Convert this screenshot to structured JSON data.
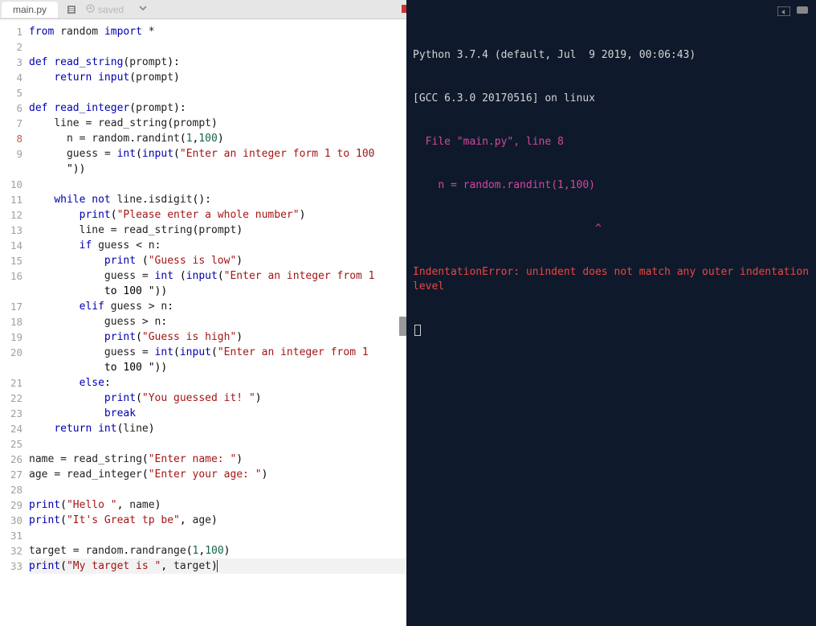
{
  "header": {
    "filename": "main.py",
    "saved_label": "saved"
  },
  "code_lines": [
    {
      "n": 1,
      "html": "<span class='kw'>from</span> <span class='id'>random</span> <span class='kw'>import</span> <span class='op'>*</span>"
    },
    {
      "n": 2,
      "html": ""
    },
    {
      "n": 3,
      "html": "<span class='kw'>def</span> <span class='fname'>read_string</span>(<span class='id'>prompt</span>):"
    },
    {
      "n": 4,
      "html": "    <span class='kw'>return</span> <span class='builtin'>input</span>(<span class='id'>prompt</span>)"
    },
    {
      "n": 5,
      "html": ""
    },
    {
      "n": 6,
      "html": "<span class='kw'>def</span> <span class='fname'>read_integer</span>(<span class='id'>prompt</span>):"
    },
    {
      "n": 7,
      "html": "    <span class='id'>line</span> <span class='op'>=</span> <span class='id'>read_string</span>(<span class='id'>prompt</span>)"
    },
    {
      "n": 8,
      "err": true,
      "html": "      <span class='id'>n</span> <span class='op'>=</span> <span class='id'>random</span>.<span class='id'>randint</span>(<span class='num'>1</span>,<span class='num'>100</span>)"
    },
    {
      "n": 9,
      "html": "      <span class='id'>guess</span> <span class='op'>=</span> <span class='builtin'>int</span>(<span class='builtin'>input</span>(<span class='str'>\"Enter an integer form 1 to 100 \n      \"</span>))"
    },
    {
      "n": 10,
      "html": ""
    },
    {
      "n": 11,
      "html": "    <span class='kw'>while</span> <span class='kw'>not</span> <span class='id'>line</span>.<span class='id'>isdigit</span>():"
    },
    {
      "n": 12,
      "html": "        <span class='builtin'>print</span>(<span class='str'>\"Please enter a whole number\"</span>)"
    },
    {
      "n": 13,
      "html": "        <span class='id'>line</span> <span class='op'>=</span> <span class='id'>read_string</span>(<span class='id'>prompt</span>)"
    },
    {
      "n": 14,
      "html": "        <span class='kw'>if</span> <span class='id'>guess</span> <span class='op'>&lt;</span> <span class='id'>n</span>:"
    },
    {
      "n": 15,
      "html": "            <span class='builtin'>print</span> (<span class='str'>\"Guess is low\"</span>)"
    },
    {
      "n": 16,
      "html": "            <span class='id'>guess</span> <span class='op'>=</span> <span class='builtin'>int</span> (<span class='builtin'>input</span>(<span class='str'>\"Enter an integer from 1 \n            to 100 \"</span>))"
    },
    {
      "n": 17,
      "html": "        <span class='kw'>elif</span> <span class='id'>guess</span> <span class='op'>&gt;</span> <span class='id'>n</span>:"
    },
    {
      "n": 18,
      "html": "            <span class='id'>guess</span> <span class='op'>&gt;</span> <span class='id'>n</span>:"
    },
    {
      "n": 19,
      "html": "            <span class='builtin'>print</span>(<span class='str'>\"Guess is high\"</span>)"
    },
    {
      "n": 20,
      "html": "            <span class='id'>guess</span> <span class='op'>=</span> <span class='builtin'>int</span>(<span class='builtin'>input</span>(<span class='str'>\"Enter an integer from 1 \n            to 100 \"</span>))"
    },
    {
      "n": 21,
      "html": "        <span class='kw'>else</span>:"
    },
    {
      "n": 22,
      "html": "            <span class='builtin'>print</span>(<span class='str'>\"You guessed it! \"</span>)"
    },
    {
      "n": 23,
      "html": "            <span class='kw'>break</span>"
    },
    {
      "n": 24,
      "html": "    <span class='kw'>return</span> <span class='builtin'>int</span>(<span class='id'>line</span>)"
    },
    {
      "n": 25,
      "html": ""
    },
    {
      "n": 26,
      "html": "<span class='id'>name</span> <span class='op'>=</span> <span class='id'>read_string</span>(<span class='str'>\"Enter name: \"</span>)"
    },
    {
      "n": 27,
      "html": "<span class='id'>age</span> <span class='op'>=</span> <span class='id'>read_integer</span>(<span class='str'>\"Enter your age: \"</span>)"
    },
    {
      "n": 28,
      "html": ""
    },
    {
      "n": 29,
      "html": "<span class='builtin'>print</span>(<span class='str'>\"Hello \"</span>, <span class='id'>name</span>)"
    },
    {
      "n": 30,
      "html": "<span class='builtin'>print</span>(<span class='str'>\"It's Great tp be\"</span>, <span class='id'>age</span>)"
    },
    {
      "n": 31,
      "html": ""
    },
    {
      "n": 32,
      "html": "<span class='id'>target</span> <span class='op'>=</span> <span class='id'>random</span>.<span class='id'>randrange</span>(<span class='num'>1</span>,<span class='num'>100</span>)"
    },
    {
      "n": 33,
      "current": true,
      "html": "<span class='builtin'>print</span>(<span class='str'>\"My target is \"</span>, <span class='id'>target</span>)<span class='cursor'></span>"
    }
  ],
  "terminal": {
    "python_header": "Python 3.7.4 (default, Jul  9 2019, 00:06:43)",
    "gcc_line": "[GCC 6.3.0 20170516] on linux",
    "tb_file": "  File \"main.py\", line 8",
    "tb_line": "    n = random.randint(1,100)",
    "caret": "                             ^",
    "error": "IndentationError: unindent does not match any outer indentation level",
    "prompt": ""
  }
}
